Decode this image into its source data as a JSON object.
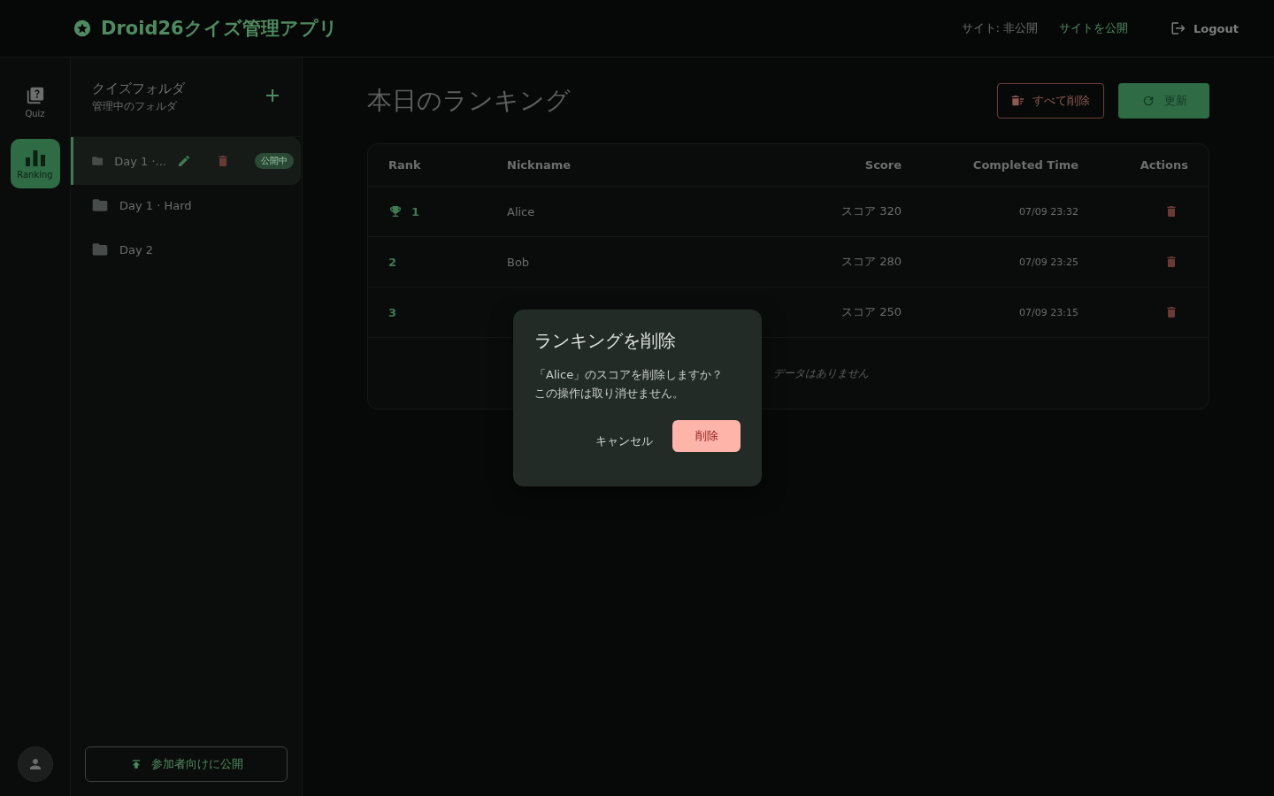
{
  "header": {
    "app_title": "Droid26クイズ管理アプリ",
    "site_status": "サイト: 非公開",
    "publish_site_link": "サイトを公開",
    "logout": "Logout"
  },
  "rail": {
    "items": [
      {
        "kind": "quiz",
        "label": "Quiz",
        "selected": false
      },
      {
        "kind": "ranking",
        "label": "Ranking",
        "selected": true
      }
    ]
  },
  "folders": {
    "title": "クイズフォルダ",
    "subtitle": "管理中のフォルダ",
    "items": [
      {
        "name": "Day 1 ·...",
        "selected": true,
        "badge": "公開中"
      },
      {
        "name": "Day 1 · Hard",
        "selected": false
      },
      {
        "name": "Day 2",
        "selected": false
      }
    ],
    "publish_button": "参加者向けに公開"
  },
  "main": {
    "title": "本日のランキング",
    "delete_all_button": "すべて削除",
    "refresh_button": "更新",
    "table": {
      "columns": [
        "Rank",
        "Nickname",
        "Score",
        "Completed Time",
        "Actions"
      ],
      "rows": [
        {
          "rank": "1",
          "top": true,
          "nickname": "Alice",
          "score": "スコア 320",
          "time": "07/09 23:32"
        },
        {
          "rank": "2",
          "top": false,
          "nickname": "Bob",
          "score": "スコア 280",
          "time": "07/09 23:25"
        },
        {
          "rank": "3",
          "top": false,
          "score": "スコア 250",
          "time": "07/09 23:15"
        }
      ],
      "empty_message": "データはありません"
    }
  },
  "dialog": {
    "title": "ランキングを削除",
    "message_lines": [
      "「Alice」のスコアを削除しますか？",
      "この操作は取り消せません。"
    ],
    "cancel": "キャンセル",
    "confirm": "削除"
  }
}
